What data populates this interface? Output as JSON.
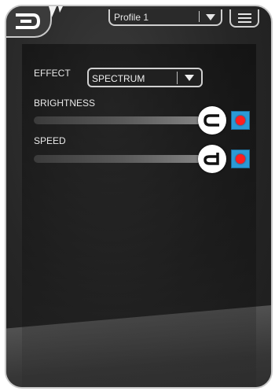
{
  "header": {
    "profile_select_value": "Profile 1"
  },
  "effect": {
    "label": "EFFECT",
    "selected": "SPECTRUM"
  },
  "brightness": {
    "label": "BRIGHTNESS",
    "knob_letter": "c",
    "value_fraction": 1.0,
    "color": "#ff1e1e"
  },
  "speed": {
    "label": "SPEED",
    "knob_letter": "d",
    "value_fraction": 1.0,
    "color": "#ff1e1e"
  },
  "icons": {
    "logo": "brand-logo-icon",
    "menu": "hamburger-menu-icon",
    "dropdown": "chevron-down-icon"
  },
  "colors": {
    "accent_blue": "#2a9ad6",
    "indicator_red": "#ff1e1e"
  }
}
